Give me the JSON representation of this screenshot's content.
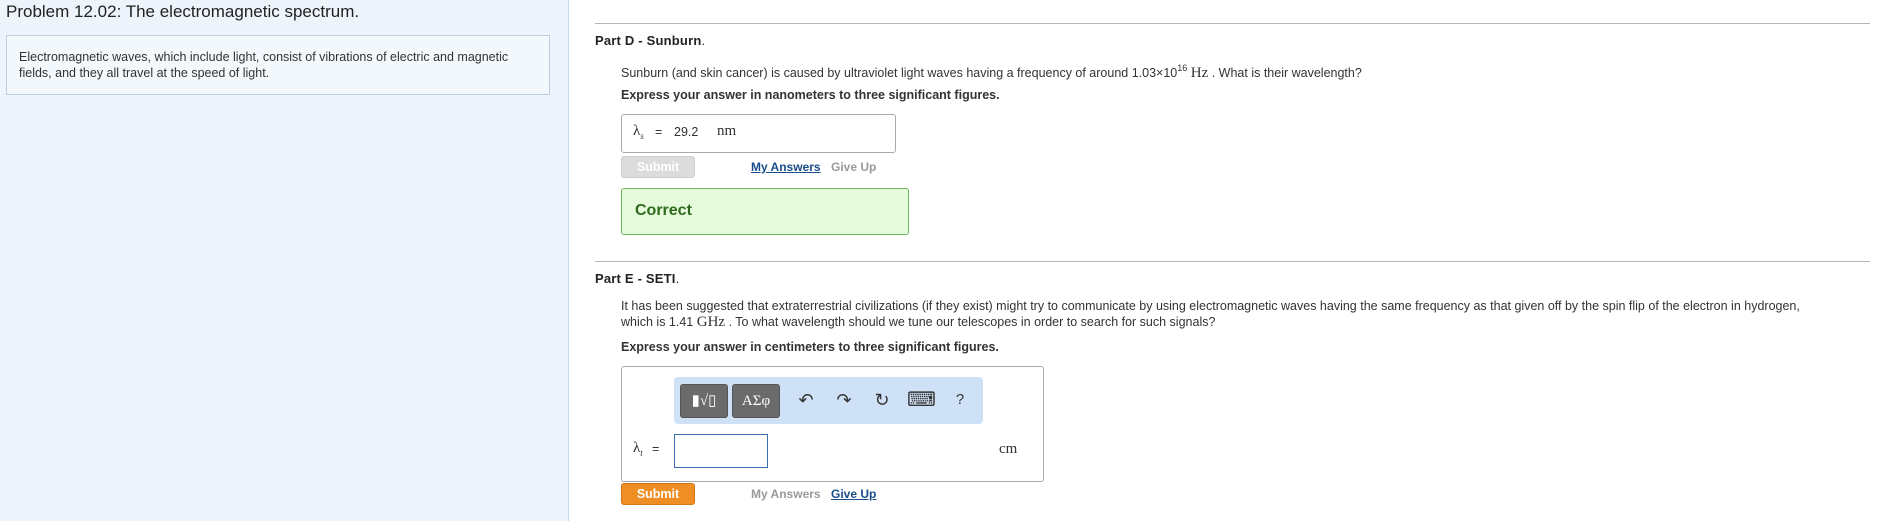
{
  "problem": {
    "title": "Problem 12.02: The electromagnetic spectrum.",
    "intro": "Electromagnetic waves, which include light, consist of vibrations of electric and magnetic fields, and they all travel at the speed of light."
  },
  "partD": {
    "title": "Part D - Sunburn",
    "title_dot": ".",
    "question_pre": "Sunburn (and skin cancer) is caused by ultraviolet light waves having a frequency of around 1.03×10",
    "question_exp": "16",
    "question_unit": "Hz",
    "question_post": ". What is their wavelength?",
    "instruction": "Express your answer in nanometers to three significant figures.",
    "answer": {
      "symbol": "λ",
      "subscript": "s",
      "equals": "=",
      "value": "29.2",
      "unit": "nm"
    },
    "submit_label": "Submit",
    "my_answers_label": "My Answers",
    "give_up_label": "Give Up",
    "result": "Correct"
  },
  "partE": {
    "title": "Part E - SETI",
    "title_dot": ".",
    "question_line1": "It has been suggested that extraterrestrial civilizations (if they exist) might try to communicate by using electromagnetic waves having the same frequency as that given off by the spin flip of the electron in hydrogen,",
    "question_line2_pre": "which is 1.41",
    "question_unit": "GHz",
    "question_line2_post": ". To what wavelength should we tune our telescopes in order to search for such signals?",
    "instruction": "Express your answer in centimeters to three significant figures.",
    "toolbar": {
      "templates_label": "▮√▯",
      "symbols_label": "ΑΣφ",
      "undo_icon": "↶",
      "redo_icon": "↷",
      "reset_icon": "↻",
      "keyboard_icon": "⌨",
      "help_label": "?"
    },
    "answer": {
      "symbol": "λ",
      "subscript": "t",
      "equals": "=",
      "value": "",
      "unit": "cm"
    },
    "submit_label": "Submit",
    "my_answers_label": "My Answers",
    "give_up_label": "Give Up"
  },
  "colors": {
    "accent_submit": "#ef8e25",
    "correct_bg": "#e6fbdc",
    "correct_border": "#6cb85a",
    "link": "#1a4c8c",
    "left_panel_bg": "#eef4fb"
  }
}
